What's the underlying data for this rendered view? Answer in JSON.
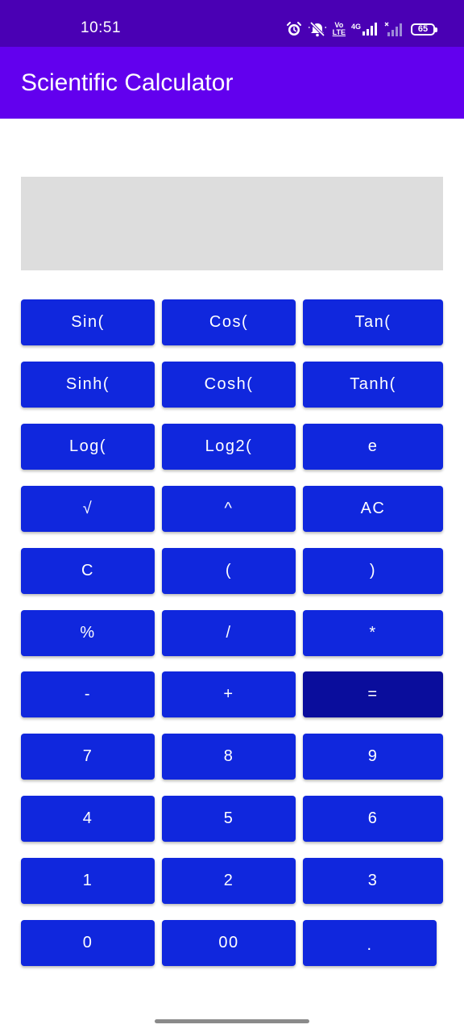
{
  "status_bar": {
    "time": "10:51",
    "volte_top": "Vo",
    "volte_bottom": "LTE",
    "network": "4G",
    "battery": "65",
    "icons": [
      "alarm-icon",
      "mute-icon",
      "volte-icon",
      "signal-icon",
      "signal-weak-icon",
      "battery-icon"
    ]
  },
  "app_bar": {
    "title": "Scientific Calculator"
  },
  "display": {
    "value": ""
  },
  "colors": {
    "status_bar": "#4a00b4",
    "app_bar": "#6200ee",
    "button": "#1027dd",
    "equals_button": "#0a0d9c",
    "display_bg": "#dddddd"
  },
  "keypad": {
    "rows": [
      [
        "Sin(",
        "Cos(",
        "Tan("
      ],
      [
        "Sinh(",
        "Cosh(",
        "Tanh("
      ],
      [
        "Log(",
        "Log2(",
        "e"
      ],
      [
        "√",
        "^",
        "AC"
      ],
      [
        "C",
        "(",
        ")"
      ],
      [
        "%",
        "/",
        "*"
      ],
      [
        "-",
        "+",
        "="
      ],
      [
        "7",
        "8",
        "9"
      ],
      [
        "4",
        "5",
        "6"
      ],
      [
        "1",
        "2",
        "3"
      ],
      [
        "0",
        "00",
        "."
      ]
    ]
  }
}
